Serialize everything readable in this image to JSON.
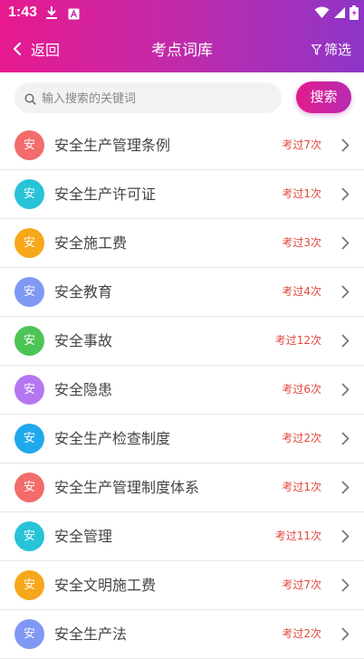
{
  "status": {
    "time": "1:43"
  },
  "nav": {
    "back_label": "返回",
    "title": "考点词库",
    "filter_label": "筛选"
  },
  "search": {
    "placeholder": "输入搜索的关键词",
    "button_label": "搜索"
  },
  "list": [
    {
      "badge": "安",
      "name": "安全生产管理条例",
      "count": "考过7次",
      "color": "#f26c6c"
    },
    {
      "badge": "安",
      "name": "安全生产许可证",
      "count": "考过1次",
      "color": "#28c3d6"
    },
    {
      "badge": "安",
      "name": "安全施工费",
      "count": "考过3次",
      "color": "#f7a71c"
    },
    {
      "badge": "安",
      "name": "安全教育",
      "count": "考过4次",
      "color": "#7f98f4"
    },
    {
      "badge": "安",
      "name": "安全事故",
      "count": "考过12次",
      "color": "#4cc456"
    },
    {
      "badge": "安",
      "name": "安全隐患",
      "count": "考过6次",
      "color": "#b577f1"
    },
    {
      "badge": "安",
      "name": "安全生产检查制度",
      "count": "考过2次",
      "color": "#1fa9ec"
    },
    {
      "badge": "安",
      "name": "安全生产管理制度体系",
      "count": "考过1次",
      "color": "#f26c6c"
    },
    {
      "badge": "安",
      "name": "安全管理",
      "count": "考过11次",
      "color": "#28c3d6"
    },
    {
      "badge": "安",
      "name": "安全文明施工费",
      "count": "考过7次",
      "color": "#f7a71c"
    },
    {
      "badge": "安",
      "name": "安全生产法",
      "count": "考过2次",
      "color": "#7f98f4"
    }
  ],
  "theme": {
    "gradient_start": "#e8198e",
    "gradient_end": "#8e35c8",
    "count_color": "#e2483d"
  }
}
